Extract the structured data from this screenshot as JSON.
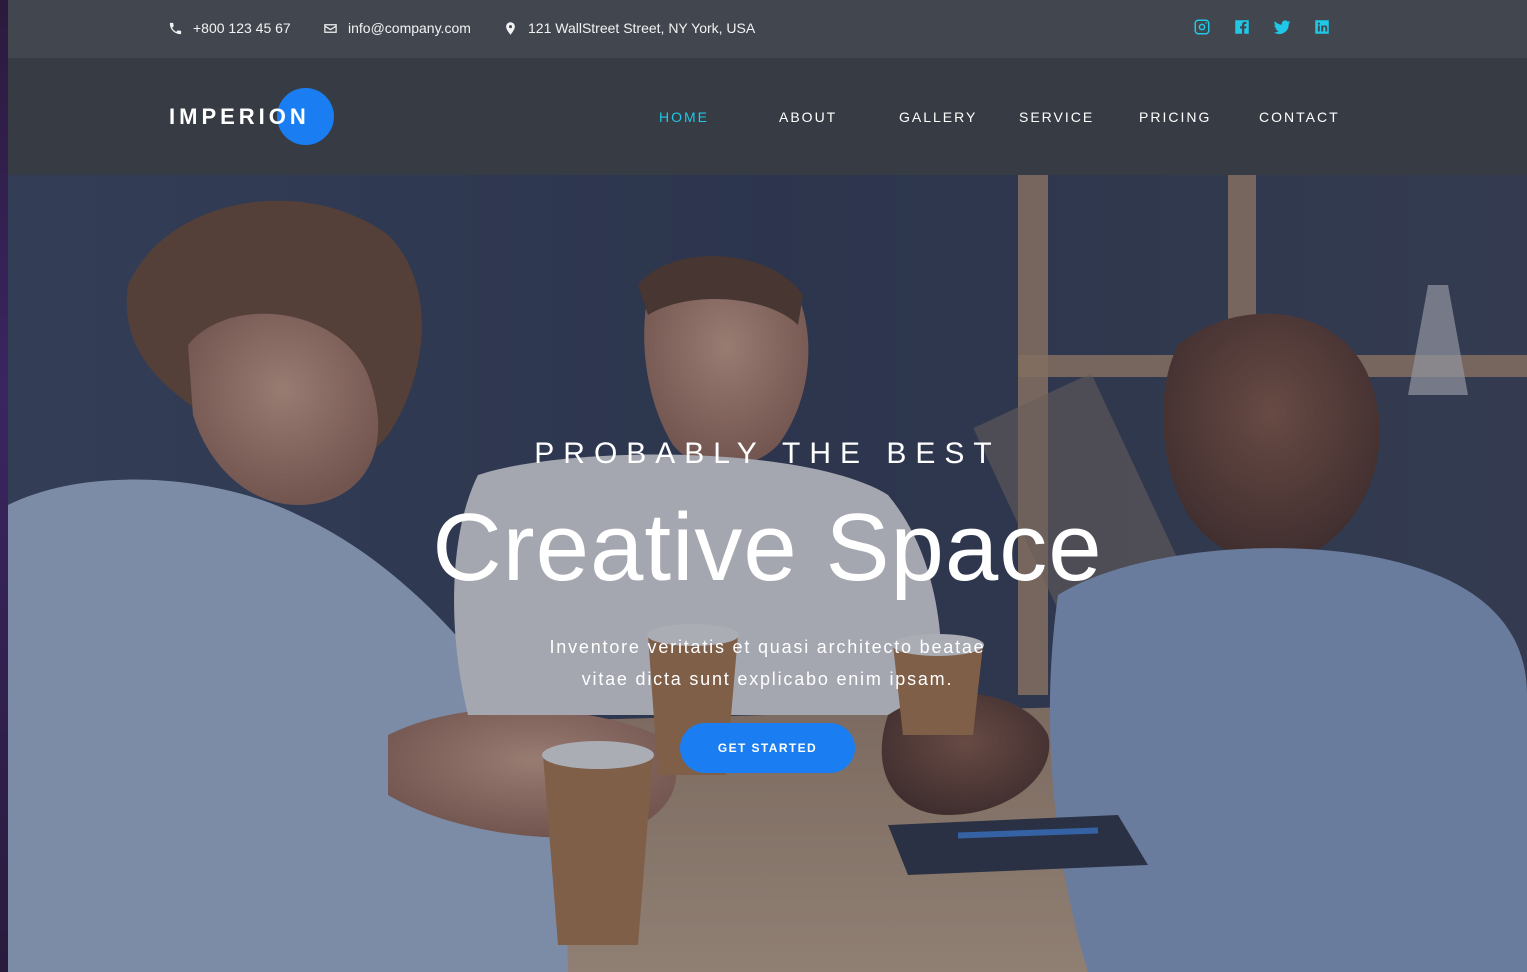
{
  "topbar": {
    "phone": "+800 123 45 67",
    "email": "info@company.com",
    "address": "121 WallStreet Street, NY York, USA",
    "social": [
      "instagram-icon",
      "facebook-icon",
      "twitter-icon",
      "linkedin-icon"
    ]
  },
  "brand": {
    "logo_text": "IMPERION",
    "accent_color": "#1a7ef2"
  },
  "nav": {
    "items": [
      {
        "label": "HOME",
        "active": true
      },
      {
        "label": "ABOUT",
        "active": false
      },
      {
        "label": "GALLERY",
        "active": false
      },
      {
        "label": "SERVICE",
        "active": false
      },
      {
        "label": "PRICING",
        "active": false
      },
      {
        "label": "CONTACT",
        "active": false
      }
    ],
    "active_color": "#1ec8e6"
  },
  "hero": {
    "kicker": "PROBABLY THE BEST",
    "headline": "Creative Space",
    "subtitle_line1": "Inventore veritatis et quasi architecto beatae",
    "subtitle_line2": "vitae dicta sunt explicabo enim ipsam.",
    "cta_label": "GET STARTED"
  }
}
